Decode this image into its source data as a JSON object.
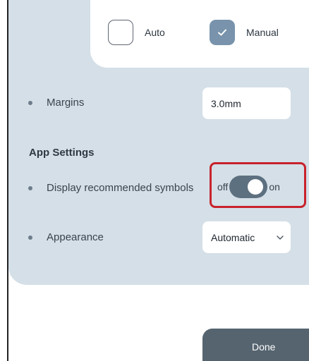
{
  "placement_options": {
    "auto_label": "Auto",
    "auto_checked": false,
    "manual_label": "Manual",
    "manual_checked": true
  },
  "margins": {
    "label": "Margins",
    "value": "3.0mm"
  },
  "app_settings": {
    "title": "App Settings",
    "recommended_symbols": {
      "label": "Display recommended symbols",
      "off_label": "off",
      "on_label": "on",
      "state": "on"
    },
    "appearance": {
      "label": "Appearance",
      "selected": "Automatic"
    }
  },
  "footer": {
    "done_label": "Done"
  },
  "colors": {
    "panel_bg": "#d4dfe7",
    "checkbox_checked": "#7893ab",
    "toggle_track": "#5d7080",
    "highlight_border": "#c8232c",
    "done_button": "#55646f"
  }
}
